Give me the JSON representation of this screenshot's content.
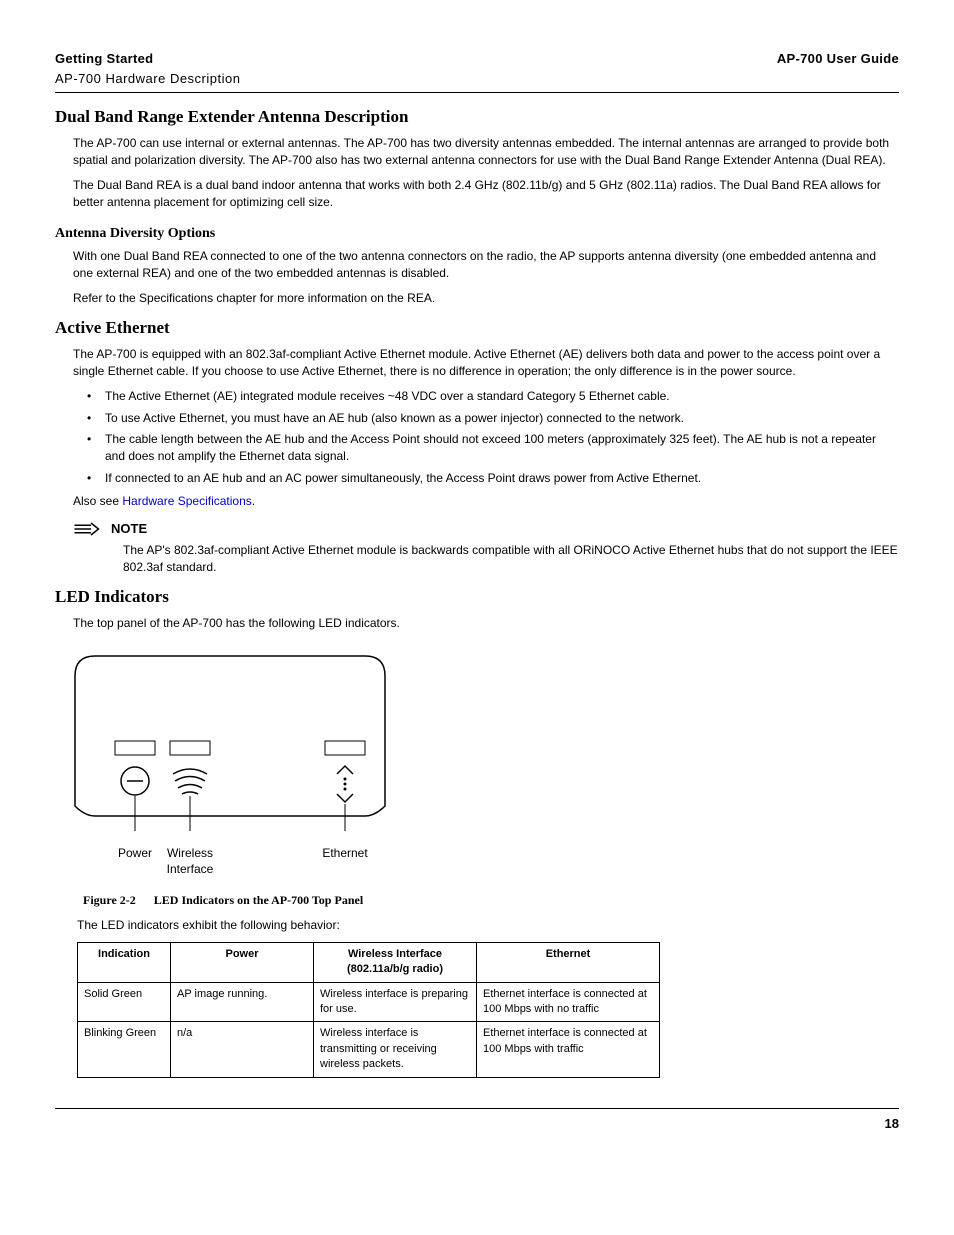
{
  "header": {
    "left": "Getting Started",
    "right": "AP-700 User Guide",
    "sub": "AP-700 Hardware Description"
  },
  "s1": {
    "title": "Dual Band Range Extender Antenna Description",
    "p1": "The AP-700 can use internal or external antennas. The AP-700 has two diversity antennas embedded.  The internal antennas are arranged to provide both spatial and polarization diversity. The AP-700 also has two external antenna connectors for use with the Dual Band Range Extender Antenna (Dual REA).",
    "p2": "The Dual Band REA is a dual band indoor antenna that works with both 2.4 GHz (802.11b/g) and 5 GHz (802.11a) radios. The Dual Band REA allows for better antenna placement for optimizing cell size."
  },
  "s2": {
    "title": "Antenna Diversity Options",
    "p1": "With one Dual Band REA connected to one of the two antenna connectors on the radio, the AP supports antenna diversity (one embedded antenna and one external REA) and one of the two embedded antennas is disabled.",
    "p2": "Refer to the Specifications chapter for more information on the REA."
  },
  "s3": {
    "title": "Active Ethernet",
    "p1": "The AP-700 is equipped with an 802.3af-compliant Active Ethernet module. Active Ethernet (AE) delivers both data and power to the access point over a single Ethernet cable. If you choose to use Active Ethernet, there is no difference in operation; the only difference is in the power source.",
    "bullets": [
      "The Active Ethernet (AE) integrated module receives ~48 VDC over a standard Category 5 Ethernet cable.",
      "To use Active Ethernet, you must have an AE hub (also known as a power injector) connected to the network.",
      "The cable length between the AE hub and the Access Point should not exceed 100 meters (approximately 325 feet). The AE hub is not a repeater and does not amplify the Ethernet data signal.",
      "If connected to an AE hub and an AC power simultaneously, the Access Point draws power from Active Ethernet."
    ],
    "also_pre": "Also see ",
    "also_link": "Hardware Specifications",
    "also_post": "."
  },
  "note": {
    "label": "NOTE",
    "body": "The AP's 802.3af-compliant Active Ethernet module is backwards compatible with all ORiNOCO Active Ethernet hubs that do not support the IEEE 802.3af standard."
  },
  "s4": {
    "title": "LED Indicators",
    "p1": "The top panel of the AP-700 has the following LED indicators.",
    "fig_labels": {
      "power": "Power",
      "wireless": "Wireless Interface",
      "ethernet": "Ethernet"
    },
    "fig_caption_num": "Figure 2-2",
    "fig_caption_text": "LED Indicators on the AP-700 Top Panel",
    "p2": "The LED indicators exhibit the following behavior:"
  },
  "table": {
    "headers": [
      "Indication",
      "Power",
      "Wireless Interface (802.11a/b/g radio)",
      "Ethernet"
    ],
    "rows": [
      [
        "Solid Green",
        "AP image running.",
        "Wireless interface is preparing for use.",
        "Ethernet interface is connected at 100 Mbps with no traffic"
      ],
      [
        "Blinking Green",
        "n/a",
        "Wireless interface is transmitting or receiving wireless packets.",
        "Ethernet interface is connected at 100 Mbps with traffic"
      ]
    ]
  },
  "page_number": "18"
}
